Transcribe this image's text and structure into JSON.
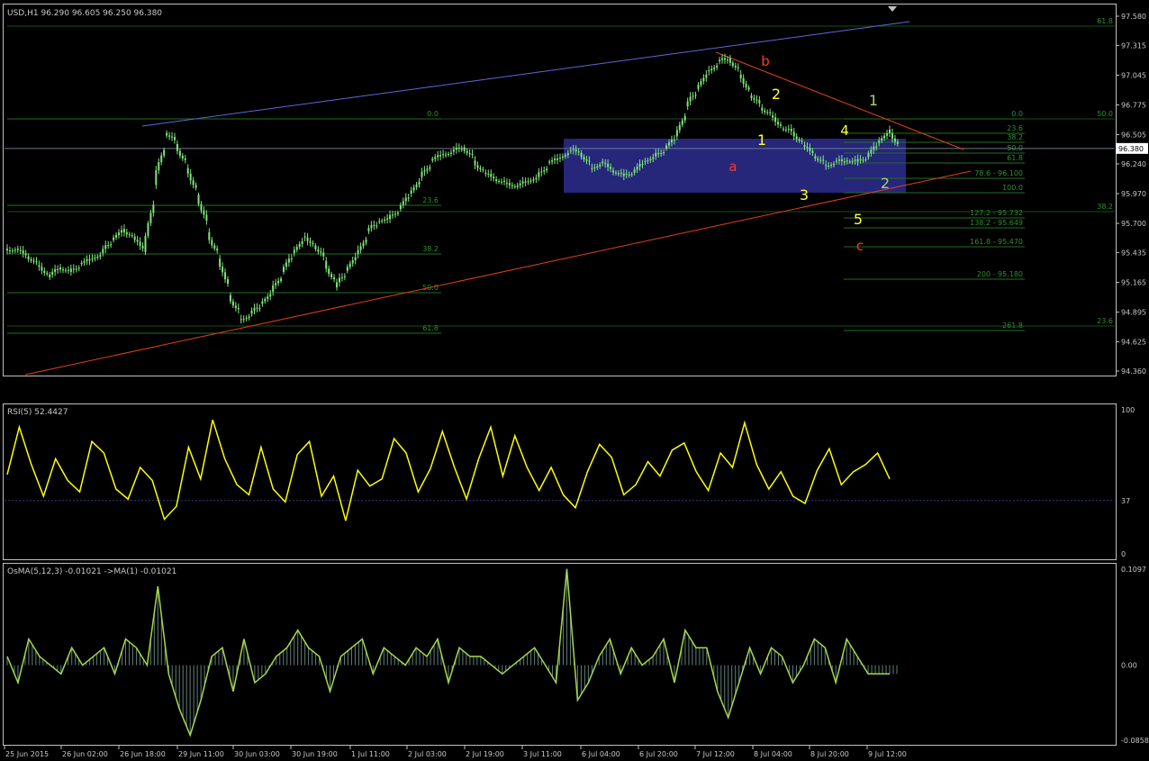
{
  "header": {
    "symbol": "USD,H1",
    "quote": "96.290 96.605 96.250 96.380"
  },
  "colors": {
    "background": "#000000",
    "frame": "#c0c0c0",
    "candle": "#7fe57a",
    "fib_line": "#1f6f1f",
    "fib_text": "#2f8f2f",
    "channel_upper": "#5a6ad8",
    "channel_lower": "#e04020",
    "box_fill": "#26267a",
    "rsi_line": "#ffff00",
    "osma": "#a6d84a",
    "wave_yellow": "#ffff33",
    "wave_red": "#ff3b1f",
    "wave_green": "#9fd86a",
    "label_text": "#c8c8c8"
  },
  "chart_data": [
    {
      "type": "line",
      "name": "price",
      "series": [
        {
          "values": [
            95.47,
            95.4,
            95.32,
            95.21,
            95.3,
            95.26,
            95.33,
            95.38,
            95.43,
            95.55,
            95.65,
            95.58,
            95.44,
            96.05,
            96.52,
            96.42,
            96.2,
            95.96,
            95.62,
            95.38,
            95.05,
            94.83,
            94.88,
            94.97,
            95.08,
            95.26,
            95.43,
            95.58,
            95.5,
            95.36,
            95.12,
            95.27,
            95.42,
            95.63,
            95.72,
            95.74,
            95.83,
            95.97,
            96.12,
            96.27,
            96.33,
            96.35,
            96.39,
            96.27,
            96.16,
            96.1,
            96.06,
            96.03,
            96.08,
            96.12,
            96.25,
            96.29,
            96.36,
            96.34,
            96.2,
            96.26,
            96.18,
            96.13,
            96.16,
            96.26,
            96.31,
            96.38,
            96.49,
            96.76,
            96.92,
            97.08,
            97.17,
            97.2,
            97.05,
            96.86,
            96.75,
            96.68,
            96.56,
            96.53,
            96.41,
            96.31,
            96.23,
            96.26,
            96.27,
            96.26,
            96.3,
            96.43,
            96.55,
            96.38
          ]
        }
      ],
      "ylim": [
        94.36,
        97.58
      ],
      "y_ticks": [
        "97.580",
        "97.315",
        "97.045",
        "96.775",
        "96.505",
        "96.240",
        "95.970",
        "95.700",
        "95.435",
        "95.165",
        "94.895",
        "94.625",
        "94.360"
      ],
      "x_ticks": [
        "25 Jun 2015",
        "26 Jun 02:00",
        "26 Jun 18:00",
        "29 Jun 11:00",
        "30 Jun 03:00",
        "30 Jun 19:00",
        "1 Jul 11:00",
        "2 Jul 03:00",
        "2 Jul 19:00",
        "3 Jul 11:00",
        "6 Jul 04:00",
        "6 Jul 20:00",
        "7 Jul 12:00",
        "8 Jul 04:00",
        "8 Jul 20:00",
        "9 Jul 12:00"
      ],
      "current_price": "96.380",
      "fib_left": [
        "0.0",
        "23.6",
        "38.2",
        "50.0",
        "61.8"
      ],
      "fib_right": [
        "0.0",
        "23.6",
        "38.2",
        "50.0",
        "61.8",
        "78.6 - 96.100",
        "100.0",
        "127.2 - 95.732",
        "138.2 - 95.649",
        "161.8 - 95.470",
        "200 - 95.180",
        "261.8"
      ],
      "fib_edge": [
        "61.8",
        "50.0",
        "38.2",
        "23.6"
      ],
      "wave_labels": [
        {
          "text": "a",
          "color": "red"
        },
        {
          "text": "b",
          "color": "red"
        },
        {
          "text": "c",
          "color": "red"
        },
        {
          "text": "1",
          "color": "yellow"
        },
        {
          "text": "2",
          "color": "yellow"
        },
        {
          "text": "1",
          "color": "yellow"
        },
        {
          "text": "3",
          "color": "yellow"
        },
        {
          "text": "4",
          "color": "yellow"
        },
        {
          "text": "5",
          "color": "yellow"
        },
        {
          "text": "1",
          "color": "green"
        },
        {
          "text": "2",
          "color": "green"
        }
      ]
    },
    {
      "type": "line",
      "name": "RSI(5)",
      "header": "RSI(5) 52.4427",
      "ylim": [
        0,
        100
      ],
      "y_ticks": [
        "100",
        "37",
        "0"
      ],
      "level": 37,
      "series": [
        {
          "values": [
            55,
            88,
            62,
            40,
            66,
            51,
            43,
            78,
            70,
            45,
            38,
            60,
            51,
            24,
            33,
            74,
            52,
            93,
            66,
            48,
            41,
            74,
            45,
            36,
            69,
            78,
            40,
            54,
            23,
            58,
            47,
            52,
            80,
            70,
            43,
            59,
            85,
            60,
            38,
            66,
            88,
            54,
            82,
            60,
            44,
            60,
            41,
            32,
            57,
            76,
            67,
            41,
            48,
            64,
            54,
            72,
            77,
            57,
            44,
            70,
            60,
            91,
            62,
            45,
            57,
            40,
            35,
            58,
            73,
            48,
            57,
            62,
            70,
            52
          ]
        }
      ]
    },
    {
      "type": "bar",
      "name": "OsMA(5,12,3)",
      "header": "OsMA(5,12,3) -0.01021   ->MA(1) -0.01021",
      "ylim": [
        -0.0858,
        0.1097
      ],
      "y_ticks": [
        "0.1097",
        "0.00",
        "-0.0858"
      ],
      "series": [
        {
          "values": [
            0.01,
            -0.02,
            0.03,
            0.01,
            0.0,
            -0.01,
            0.02,
            0.0,
            0.01,
            0.02,
            -0.01,
            0.03,
            0.02,
            0.0,
            0.09,
            -0.01,
            -0.05,
            -0.08,
            -0.04,
            0.01,
            0.02,
            -0.03,
            0.03,
            -0.02,
            -0.01,
            0.01,
            0.02,
            0.04,
            0.02,
            0.01,
            -0.03,
            0.01,
            0.02,
            0.03,
            -0.01,
            0.02,
            0.01,
            0.0,
            0.02,
            0.01,
            0.03,
            -0.02,
            0.02,
            0.01,
            0.01,
            0.0,
            -0.01,
            0.0,
            0.01,
            0.02,
            0.0,
            -0.02,
            0.11,
            -0.04,
            -0.02,
            0.01,
            0.03,
            -0.01,
            0.02,
            0.0,
            0.01,
            0.03,
            -0.02,
            0.04,
            0.02,
            0.02,
            -0.03,
            -0.06,
            -0.02,
            0.02,
            -0.01,
            0.02,
            0.01,
            -0.02,
            0.0,
            0.03,
            0.02,
            -0.02,
            0.03,
            0.01,
            -0.01,
            -0.01,
            -0.01
          ]
        }
      ]
    }
  ]
}
